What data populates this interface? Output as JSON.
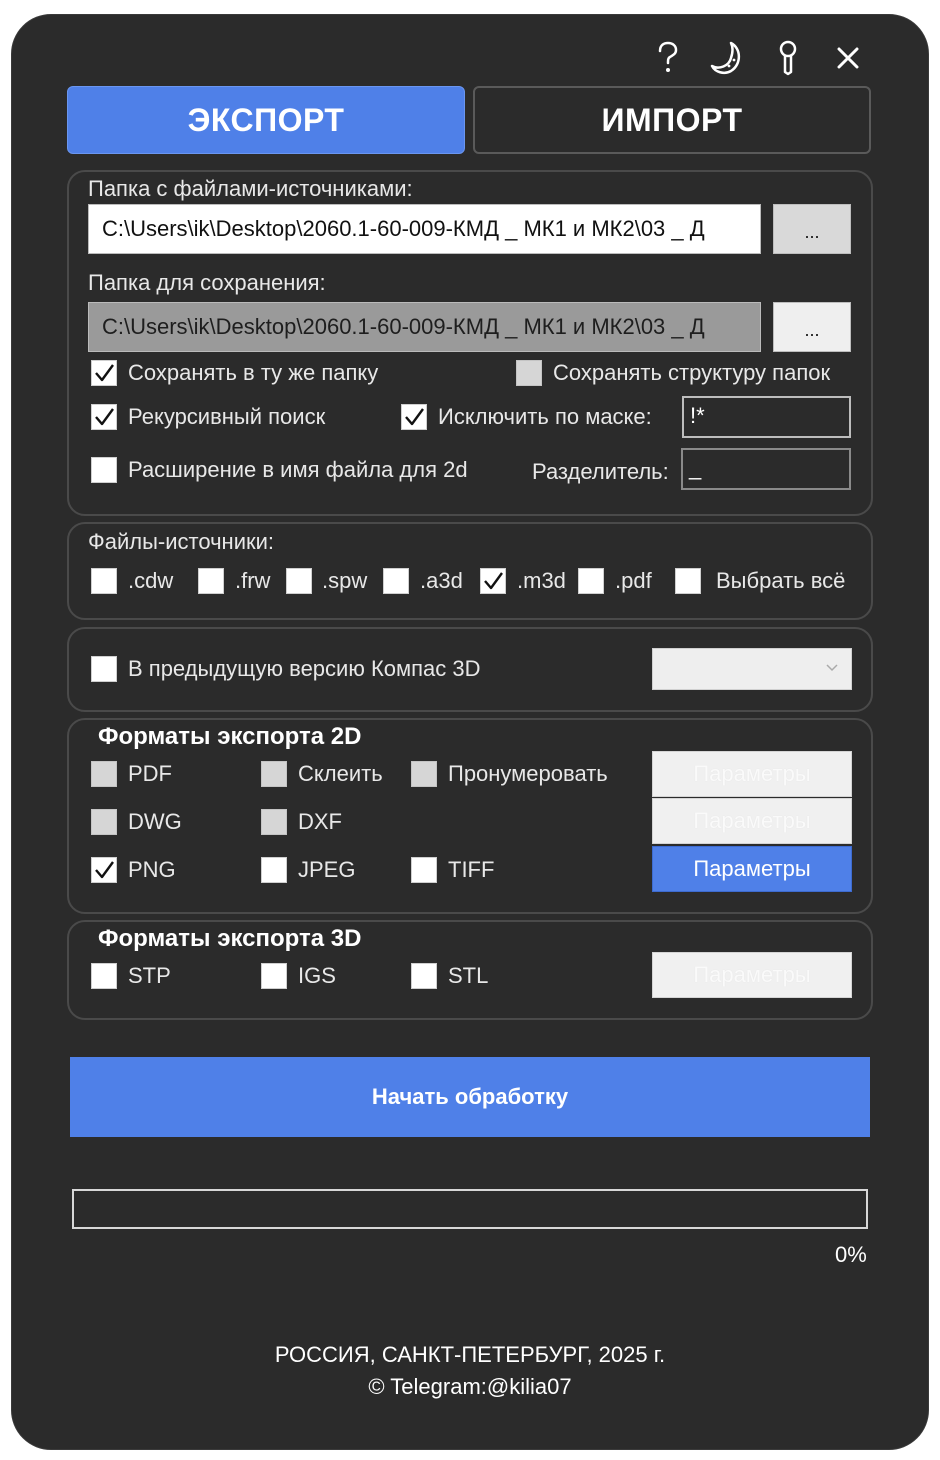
{
  "window": {
    "icons": [
      "question-icon",
      "moon-icon",
      "pin-icon",
      "close-icon"
    ]
  },
  "tabs": {
    "export_label": "ЭКСПОРТ",
    "import_label": "ИМПОРТ"
  },
  "paths": {
    "source_label": "Папка с файлами-источниками:",
    "source_value": "C:\\Users\\ik\\Desktop\\2060.1-60-009-КМД _ МК1 и МК2\\03 _ Д",
    "source_browse": "...",
    "save_label": "Папка для сохранения:",
    "save_value": "C:\\Users\\ik\\Desktop\\2060.1-60-009-КМД _ МК1 и МК2\\03 _ Д",
    "save_browse": "..."
  },
  "options": {
    "same_folder": {
      "label": "Сохранять в ту же папку",
      "checked": true
    },
    "keep_structure": {
      "label": "Сохранять структуру папок",
      "checked": false,
      "disabled": true
    },
    "recursive": {
      "label": "Рекурсивный поиск",
      "checked": true
    },
    "exclude_mask": {
      "label": "Исключить по маске:",
      "checked": true,
      "value": "!*"
    },
    "ext_in_name": {
      "label": "Расширение в имя файла для 2d",
      "checked": false
    },
    "separator": {
      "label": "Разделитель:",
      "value": "_"
    }
  },
  "sources": {
    "title": "Файлы-источники:",
    "items": [
      {
        "label": ".cdw",
        "checked": false
      },
      {
        "label": ".frw",
        "checked": false
      },
      {
        "label": ".spw",
        "checked": false
      },
      {
        "label": ".a3d",
        "checked": false
      },
      {
        "label": ".m3d",
        "checked": true
      },
      {
        "label": ".pdf",
        "checked": false
      },
      {
        "label": "Выбрать всё",
        "checked": false
      }
    ]
  },
  "version": {
    "label": "В предыдущую версию Компас 3D",
    "checked": false,
    "selected": ""
  },
  "formats2d": {
    "title": "Форматы экспорта 2D",
    "pdf": {
      "label": "PDF",
      "checked": false,
      "disabled": true
    },
    "merge": {
      "label": "Склеить",
      "checked": false,
      "disabled": true
    },
    "number": {
      "label": "Пронумеровать",
      "checked": false,
      "disabled": true
    },
    "dwg": {
      "label": "DWG",
      "checked": false,
      "disabled": true
    },
    "dxf": {
      "label": "DXF",
      "checked": false,
      "disabled": true
    },
    "png": {
      "label": "PNG",
      "checked": true
    },
    "jpeg": {
      "label": "JPEG",
      "checked": false
    },
    "tiff": {
      "label": "TIFF",
      "checked": false
    },
    "params1": "Параметры",
    "params2": "Параметры",
    "params3": "Параметры"
  },
  "formats3d": {
    "title": "Форматы экспорта 3D",
    "stp": {
      "label": "STP",
      "checked": false
    },
    "igs": {
      "label": "IGS",
      "checked": false
    },
    "stl": {
      "label": "STL",
      "checked": false
    },
    "params": "Параметры"
  },
  "actions": {
    "start_label": "Начать обработку"
  },
  "progress": {
    "value": 0,
    "text": "0%"
  },
  "footer": {
    "line1": "РОССИЯ, САНКТ-ПЕТЕРБУРГ, 2025 г.",
    "line2": "© Telegram:@kilia07"
  },
  "colors": {
    "background": "#2b2b2b",
    "accent": "#4f80e8"
  }
}
